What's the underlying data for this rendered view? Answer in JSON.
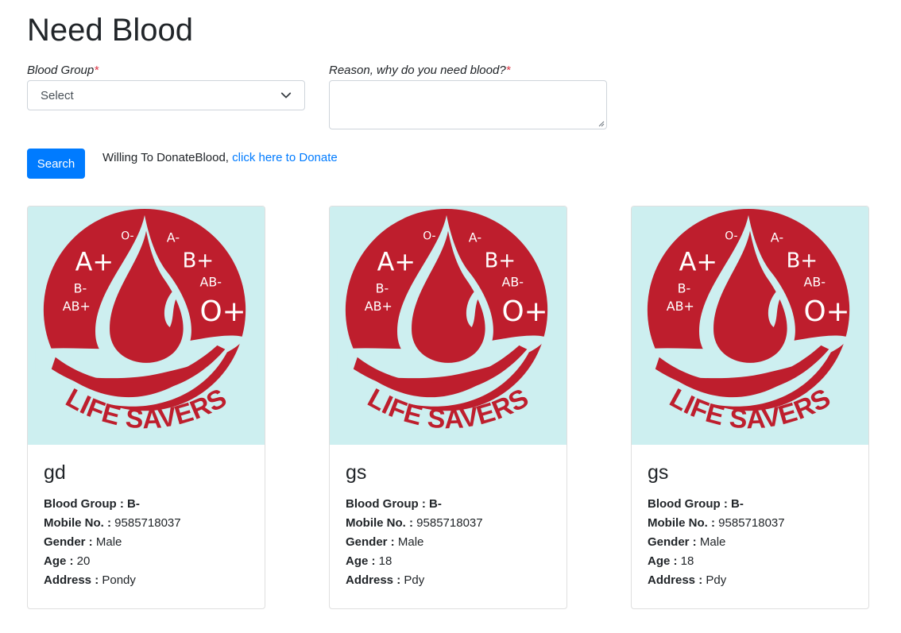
{
  "page_title": "Need Blood",
  "form": {
    "blood_group_label": "Blood Group",
    "blood_group_selected": "Select",
    "reason_label": "Reason, why do you need blood?",
    "required_mark": "*",
    "search_label": "Search"
  },
  "donate": {
    "text": "Willing To DonateBlood,",
    "link_text": "click here to Donate"
  },
  "logo": {
    "text": "LIFE SAVERS",
    "groups": [
      "O-",
      "A-",
      "A+",
      "B+",
      "B-",
      "AB-",
      "AB+",
      "O+"
    ]
  },
  "field_labels": {
    "blood_group": "Blood Group :",
    "mobile": "Mobile No. :",
    "gender": "Gender :",
    "age": "Age :",
    "address": "Address :"
  },
  "cards": [
    {
      "name": "gd",
      "blood_group": "B-",
      "mobile": "9585718037",
      "gender": "Male",
      "age": "20",
      "address": "Pondy"
    },
    {
      "name": "gs",
      "blood_group": "B-",
      "mobile": "9585718037",
      "gender": "Male",
      "age": "18",
      "address": "Pdy"
    },
    {
      "name": "gs",
      "blood_group": "B-",
      "mobile": "9585718037",
      "gender": "Male",
      "age": "18",
      "address": "Pdy"
    }
  ],
  "colors": {
    "primary": "#007bff",
    "logo_red": "#be1e2d",
    "logo_bg": "#cdeff0",
    "required": "#dc3545"
  }
}
